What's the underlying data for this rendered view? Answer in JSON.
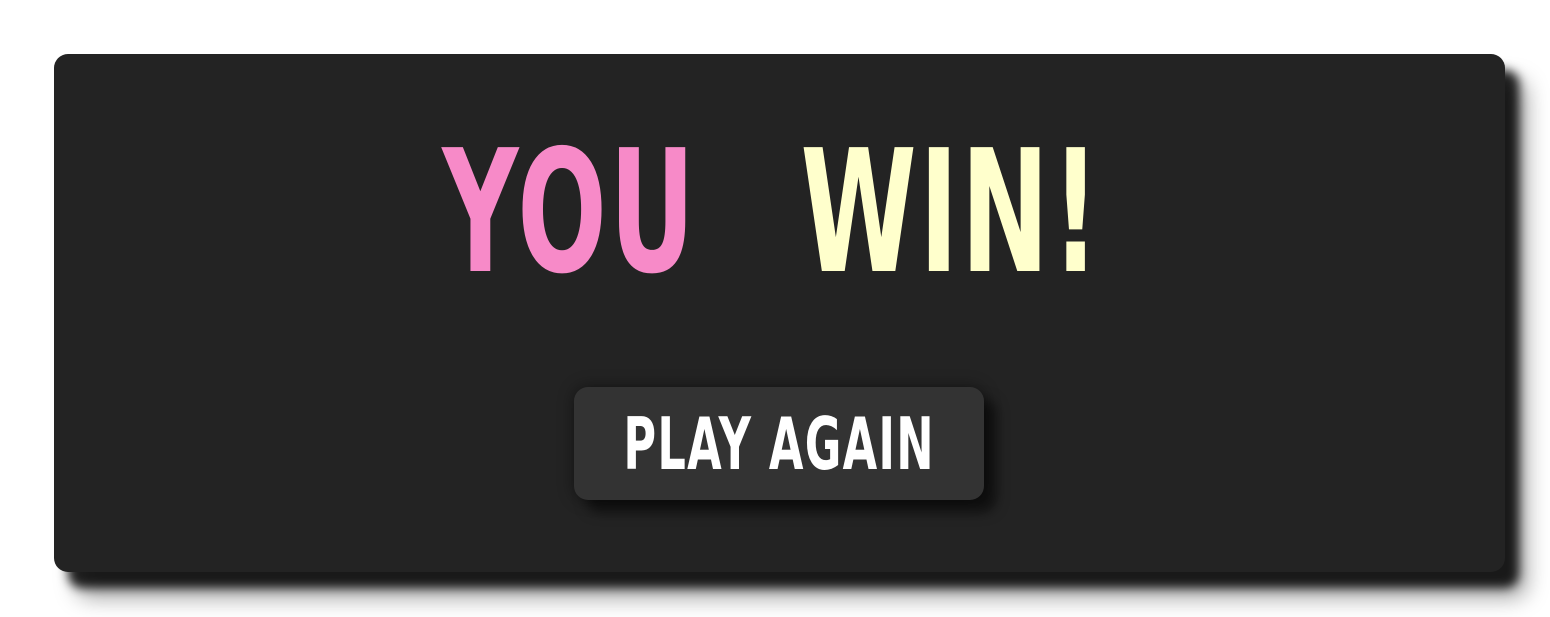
{
  "result_dialog": {
    "title_part1": "YOU",
    "title_part2": "WIN!",
    "play_again_label": "PLAY AGAIN"
  },
  "colors": {
    "panel_background": "#232323",
    "title_part1": "#f78ac8",
    "title_part2": "#ffffcc",
    "button_background": "#333333",
    "button_text": "#ffffff"
  }
}
